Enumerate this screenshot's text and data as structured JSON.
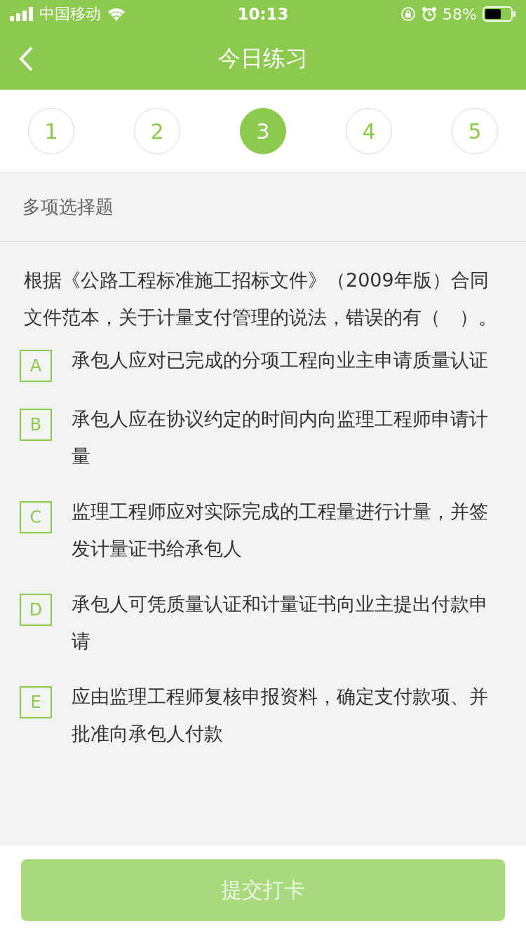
{
  "status_bar": {
    "carrier": "中国移动",
    "time": "10:13",
    "battery": "58%"
  },
  "nav": {
    "title": "今日练习"
  },
  "steps": [
    {
      "label": "1",
      "selected": false
    },
    {
      "label": "2",
      "selected": false
    },
    {
      "label": "3",
      "selected": true
    },
    {
      "label": "4",
      "selected": false
    },
    {
      "label": "5",
      "selected": false
    }
  ],
  "section": {
    "title": "多项选择题"
  },
  "question": "根据《公路工程标准施工招标文件》（2009年版）合同文件范本，关于计量支付管理的说法，错误的有（　）。",
  "options": [
    {
      "letter": "A",
      "text": "承包人应对已完成的分项工程向业主申请质量认证",
      "selected": false
    },
    {
      "letter": "B",
      "text": "承包人应在协议约定的时间内向监理工程师申请计量",
      "selected": false
    },
    {
      "letter": "C",
      "text": "监理工程师应对实际完成的工程量进行计量，并签发计量证书给承包人",
      "selected": false
    },
    {
      "letter": "D",
      "text": "承包人可凭质量认证和计量证书向业主提出付款申请",
      "selected": false
    },
    {
      "letter": "E",
      "text": "应由监理工程师复核申报资料，确定支付款项、并批准向承包人付款",
      "selected": false
    }
  ],
  "submit": {
    "label": "提交打卡",
    "disabled": true
  }
}
